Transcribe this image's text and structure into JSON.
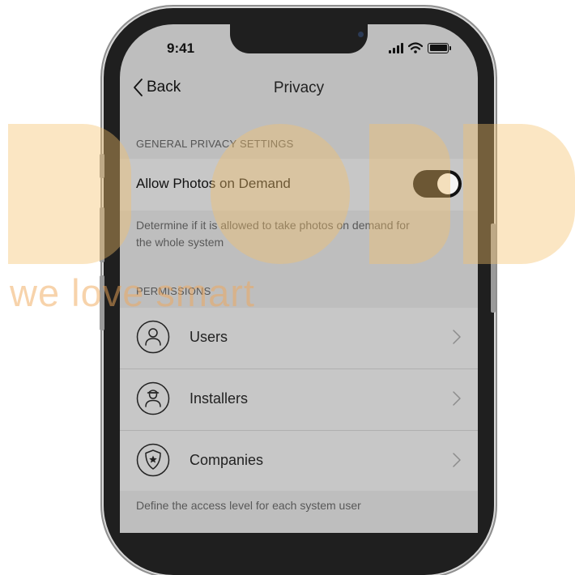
{
  "status_bar": {
    "time": "9:41"
  },
  "nav": {
    "back_label": "Back",
    "title": "Privacy"
  },
  "general_section": {
    "header": "GENERAL PRIVACY SETTINGS",
    "toggle": {
      "label": "Allow Photos on Demand",
      "enabled": true
    },
    "caption_line1": "Determine if it is allowed to take photos on demand for",
    "caption_line2": "the whole system"
  },
  "permissions_section": {
    "header": "PERMISSIONS",
    "items": [
      {
        "label": "Users",
        "icon": "user-icon"
      },
      {
        "label": "Installers",
        "icon": "installer-icon"
      },
      {
        "label": "Companies",
        "icon": "shield-star-icon"
      }
    ],
    "caption": "Define the access level for each system user"
  },
  "watermark": {
    "tagline": "we love smart"
  },
  "colors": {
    "screen_bg": "#bebebe",
    "row_bg": "#c7c7c7",
    "toggle_on": "#111111",
    "frame": "#1f1f1f",
    "watermark": "#f5c16a"
  }
}
